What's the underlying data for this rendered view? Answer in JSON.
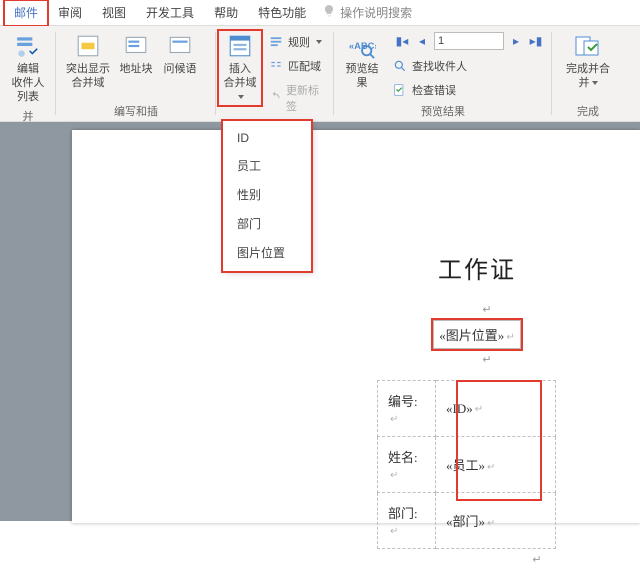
{
  "tabs": {
    "items": [
      "邮件",
      "审阅",
      "视图",
      "开发工具",
      "帮助",
      "特色功能"
    ],
    "active": 0,
    "tellme": "操作说明搜索"
  },
  "ribbon": {
    "edit_recipients": "编辑\n收件人列表",
    "highlight_merge": "突出显示\n合并域",
    "address_block": "地址块",
    "greeting_line": "问候语",
    "insert_merge_field": "插入\n合并域",
    "rules": "规则",
    "match_fields": "匹配域",
    "update_labels": "更新标签",
    "preview_results": "预览结果",
    "record_value": "1",
    "find_recipient": "查找收件人",
    "check_errors": "检查错误",
    "finish_merge": "完成并合并",
    "group_label_left": "并",
    "group_write": "编写和插",
    "group_preview": "预览结果",
    "group_finish": "完成"
  },
  "dropdown": {
    "items": [
      "ID",
      "员工",
      "性别",
      "部门",
      "图片位置"
    ]
  },
  "doc": {
    "title": "工作证",
    "img_field": "«图片位置»",
    "rows": [
      {
        "label": "编号:",
        "value": "«ID»"
      },
      {
        "label": "姓名:",
        "value": "«员工»"
      },
      {
        "label": "部门:",
        "value": "«部门»"
      }
    ],
    "para": "↵"
  }
}
